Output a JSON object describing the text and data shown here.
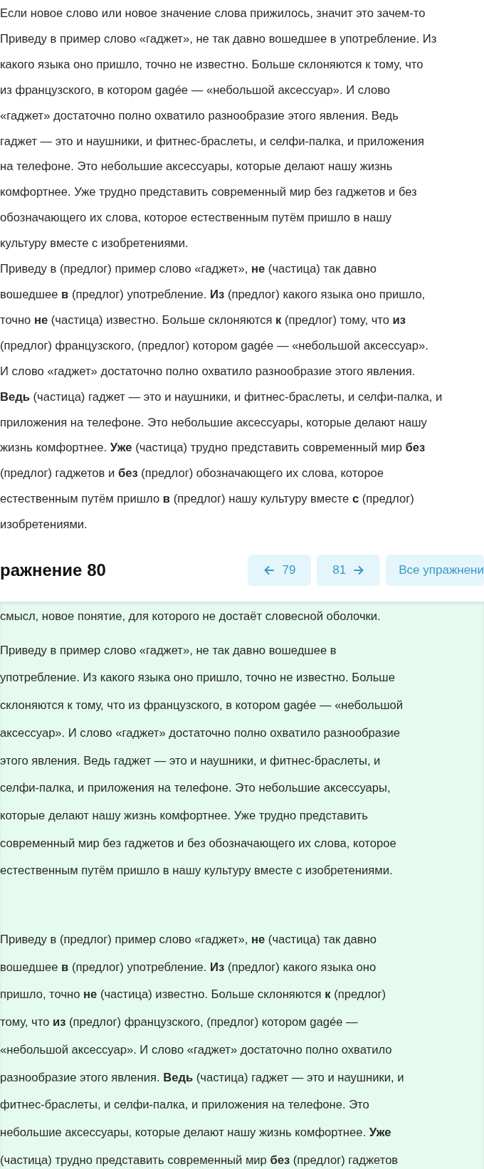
{
  "top_text": {
    "paragraphs": [
      {
        "lines": [
          "Если новое слово или новое значение слова прижилось, значит это зачем-то"
        ]
      },
      {
        "lines": [
          "Приведу в пример слово «гаджет», не так давно вошедшее в употребление. Из",
          "какого языка оно пришло, точно не известно. Больше склоняются к тому, что",
          "из французского, в котором gagée — «небольшой аксессуар». И слово",
          "«гаджет» достаточно полно охватило разнообразие этого явления. Ведь",
          "гаджет — это и наушники, и фитнес-браслеты, и селфи-палка, и приложения",
          "на телефоне. Это небольшие аксессуары, которые делают нашу жизнь",
          "комфортнее. Уже трудно представить современный мир без гаджетов и без",
          "обозначающего их слова, которое естественным путём пришло в нашу",
          "культуру вместе с изобретениями."
        ]
      },
      {
        "lines": [
          "Приведу в (предлог) пример слово «гаджет», **не** (частица) так давно",
          "вошедшее **в** (предлог) употребление. **Из** (предлог) какого языка оно пришло,",
          "точно **не** (частица) известно. Больше склоняются **к** (предлог) тому, что **из**",
          "(предлог) французского, (предлог) котором gagée — «небольшой аксессуар».",
          "И слово «гаджет» достаточно полно охватило разнообразие этого явления.",
          "**Ведь** (частица) гаджет — это и наушники, и фитнес-браслеты, и селфи-палка, и",
          "приложения на телефоне. Это небольшие аксессуары, которые делают нашу",
          "жизнь комфортнее. **Уже** (частица) трудно представить современный мир **без**",
          "(предлог) гаджетов и **без** (предлог) обозначающего их слова, которое",
          "естественным путём пришло **в** (предлог) нашу культуру вместе **с** (предлог)",
          "изобретениями."
        ]
      }
    ]
  },
  "exercise_header": {
    "title": "ражнение 80",
    "buttons": [
      {
        "kind": "prev",
        "label": "79"
      },
      {
        "kind": "next",
        "label": "81"
      },
      {
        "kind": "all",
        "label": "Все упражнени"
      }
    ]
  },
  "answer": {
    "paragraphs": [
      {
        "lines": [
          "смысл, новое понятие, для которого не достаёт словесной оболочки."
        ]
      },
      {
        "lines": [
          "Приведу в пример слово «гаджет», не так давно вошедшее в",
          "употребление. Из какого языка оно пришло, точно не известно. Больше",
          "склоняются к тому, что из французского, в котором gagée — «небольшой",
          "аксессуар». И слово «гаджет» достаточно полно охватило разнообразие",
          "этого явления. Ведь гаджет — это и наушники, и фитнес-браслеты, и",
          "селфи-палка, и приложения на телефоне. Это небольшие аксессуары,",
          "которые делают нашу жизнь комфортнее. Уже трудно представить",
          "современный мир без гаджетов и без обозначающего их слова, которое",
          "естественным путём пришло в нашу культуру вместе с изобретениями."
        ]
      },
      {
        "lines": [
          "Приведу в (предлог) пример слово «гаджет», **не** (частица) так давно",
          "вошедшее **в** (предлог) употребление. **Из** (предлог) какого языка оно",
          "пришло, точно **не** (частица) известно. Больше склоняются **к** (предлог)",
          "тому, что **из** (предлог) французского, (предлог) котором gagée —",
          "«небольшой аксессуар». И слово «гаджет» достаточно полно охватило",
          "разнообразие этого явления. **Ведь** (частица) гаджет — это и наушники, и",
          "фитнес-браслеты, и селфи-палка, и приложения на телефоне. Это",
          "небольшие аксессуары, которые делают нашу жизнь комфортнее. **Уже**",
          "(частица) трудно представить современный мир **без** (предлог) гаджетов"
        ]
      }
    ]
  }
}
